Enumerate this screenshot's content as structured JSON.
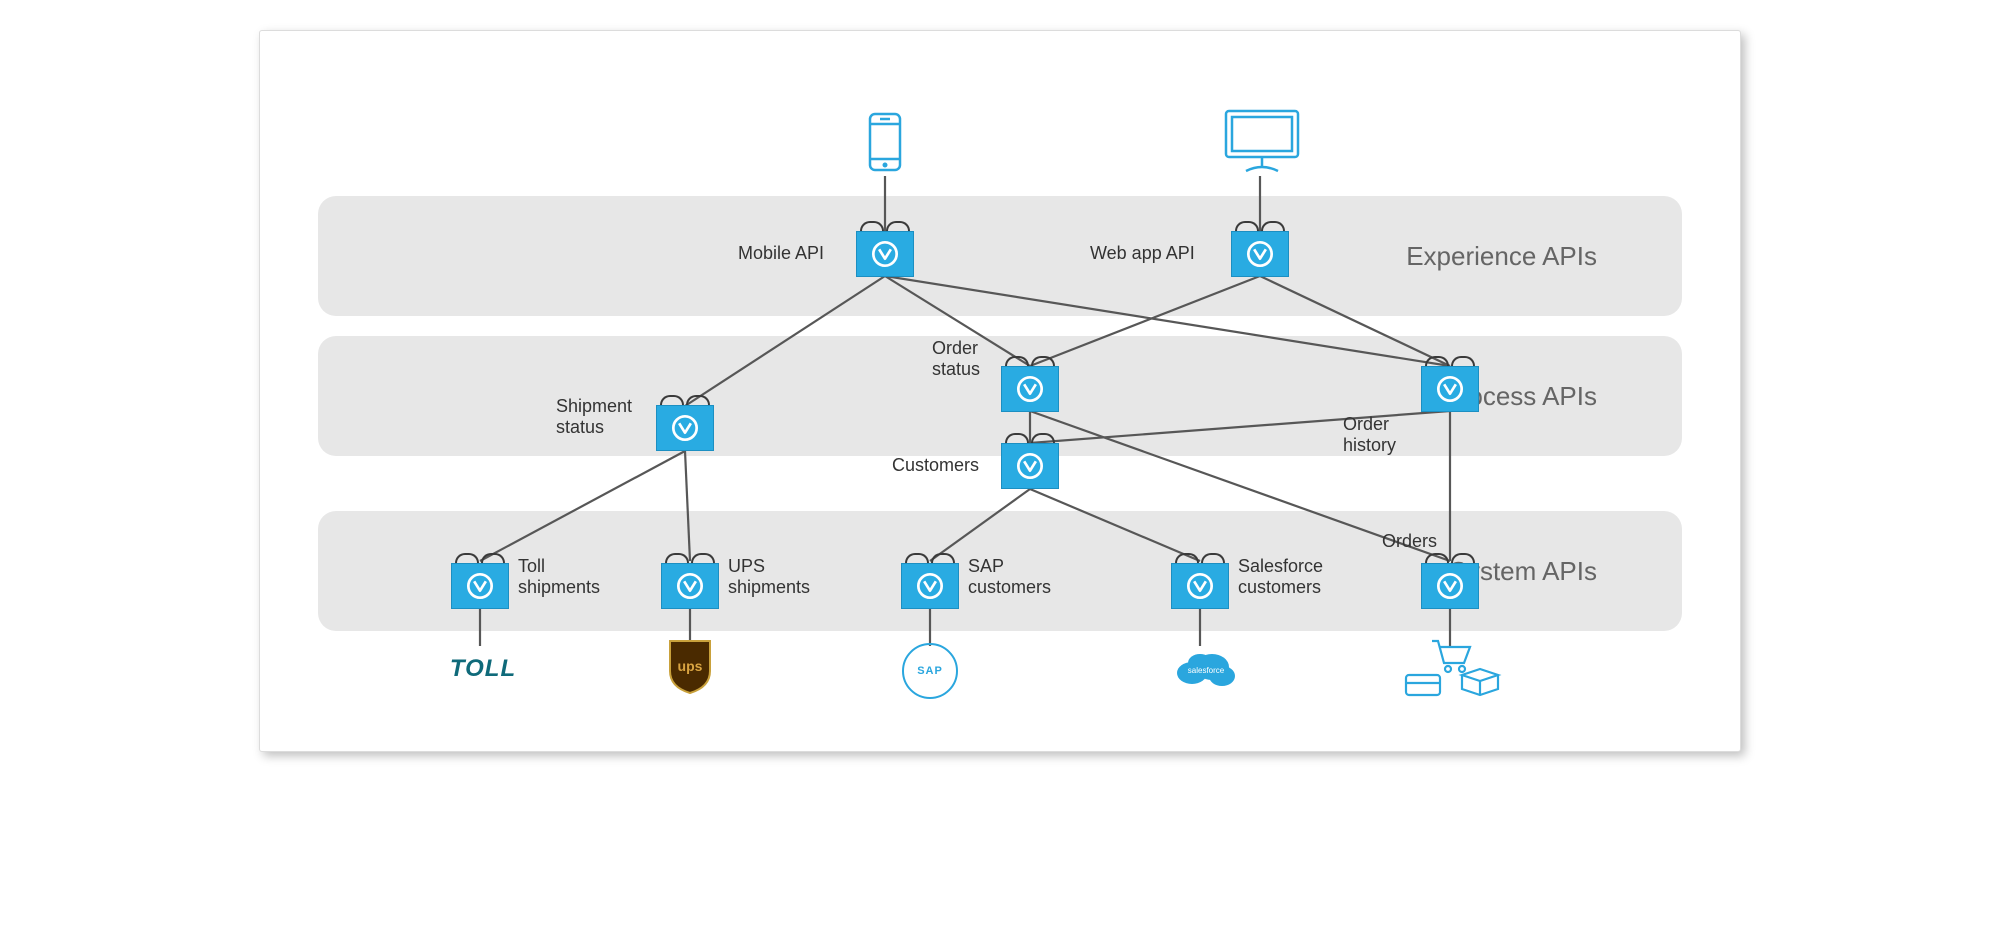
{
  "layers": {
    "experience": "Experience\nAPIs",
    "process": "Process\nAPIs",
    "system": "System\nAPIs"
  },
  "nodes": {
    "mobile_api": "Mobile API",
    "webapp_api": "Web app API",
    "shipment_status": "Shipment\nstatus",
    "order_status": "Order\nstatus",
    "order_history": "Order\nhistory",
    "customers": "Customers",
    "toll_shipments": "Toll\nshipments",
    "ups_shipments": "UPS\nshipments",
    "sap_customers": "SAP\ncustomers",
    "salesforce_customers": "Salesforce\ncustomers",
    "orders": "Orders"
  },
  "devices": {
    "mobile": "mobile-icon",
    "desktop": "desktop-icon"
  },
  "logos": {
    "toll": "TOLL",
    "ups": "ups",
    "sap": "SAP",
    "salesforce": "salesforce",
    "commerce": "commerce-icons"
  },
  "colors": {
    "node": "#29ABE2",
    "accent": "#2aa6de",
    "band": "#e7e7e7",
    "line": "#575757"
  }
}
